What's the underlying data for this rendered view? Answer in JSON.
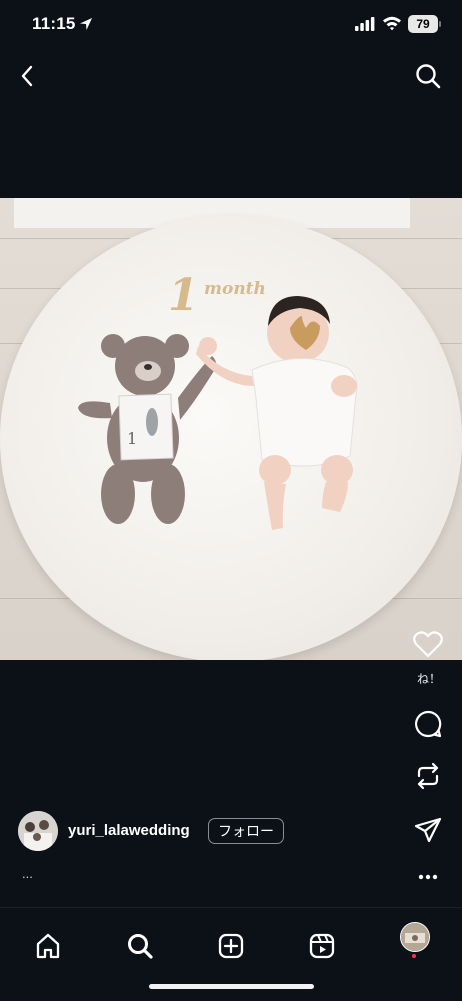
{
  "status_bar": {
    "time": "11:15",
    "battery": "79"
  },
  "header": {
    "back_icon": "chevron-left-icon",
    "search_icon": "search-icon"
  },
  "post": {
    "photo_text": {
      "number": "1",
      "word": "month"
    },
    "card_number": "1",
    "like_label": "ね！",
    "username": "yuri_lalawedding",
    "follow_label": "フォロー",
    "caption_more": "..."
  },
  "actions": {
    "like_icon": "heart-icon",
    "comment_icon": "comment-icon",
    "repost_icon": "repost-icon",
    "share_icon": "send-icon",
    "more_icon": "more-icon"
  },
  "bottom_nav": {
    "home_icon": "home-icon",
    "search_icon": "search-icon",
    "create_icon": "plus-square-icon",
    "reels_icon": "reels-icon"
  },
  "colors": {
    "background": "#0c1017",
    "notification": "#ff3040"
  }
}
